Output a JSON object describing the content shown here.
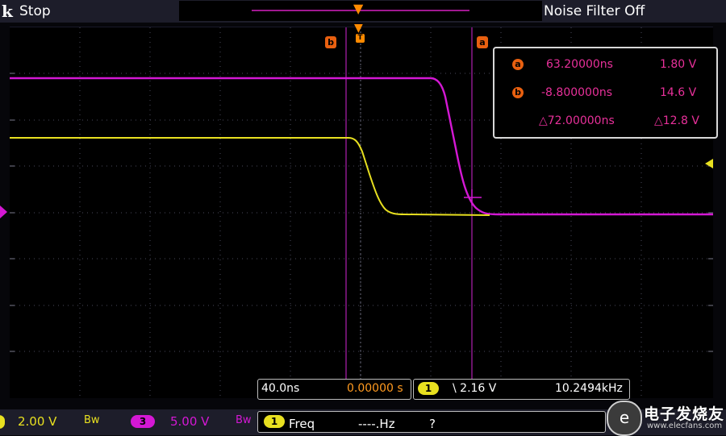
{
  "status_bar": {
    "brand": "k",
    "acquisition_state": "Stop",
    "noise_filter": "Noise Filter Off"
  },
  "cursor_tags": {
    "a": "a",
    "b": "b"
  },
  "cursor_readout": {
    "a": {
      "badge": "a",
      "time": "63.20000ns",
      "volts": "1.80 V"
    },
    "b": {
      "badge": "b",
      "time": "-8.800000ns",
      "volts": "14.6 V"
    },
    "delta": {
      "time": "△72.00000ns",
      "volts": "△12.8 V"
    }
  },
  "timebase": {
    "scale": "40.0ns",
    "delay": "0.00000 s"
  },
  "trigger": {
    "channel": "1",
    "slope_level": "\\ 2.16 V",
    "frequency": "10.2494kHz"
  },
  "channels": {
    "ch1": {
      "scale": "2.00 V",
      "bw": "Bw",
      "color": "#e8e020"
    },
    "ch3": {
      "badge": "3",
      "scale": "5.00 V",
      "bw": "Bw",
      "color": "#d418d4"
    }
  },
  "measurement": {
    "badge": "1",
    "name": "Freq",
    "value": "----.Hz",
    "flag": "?"
  },
  "watermark": {
    "logo": "e",
    "text": "电子发烧友",
    "url": "www.elecfans.com"
  },
  "colors": {
    "ch1_trace": "#e8e020",
    "ch3_trace": "#d418d4",
    "cursor": "#b020b0",
    "cursor_badge": "#e86010",
    "graticule": "#4a4a5c"
  }
}
